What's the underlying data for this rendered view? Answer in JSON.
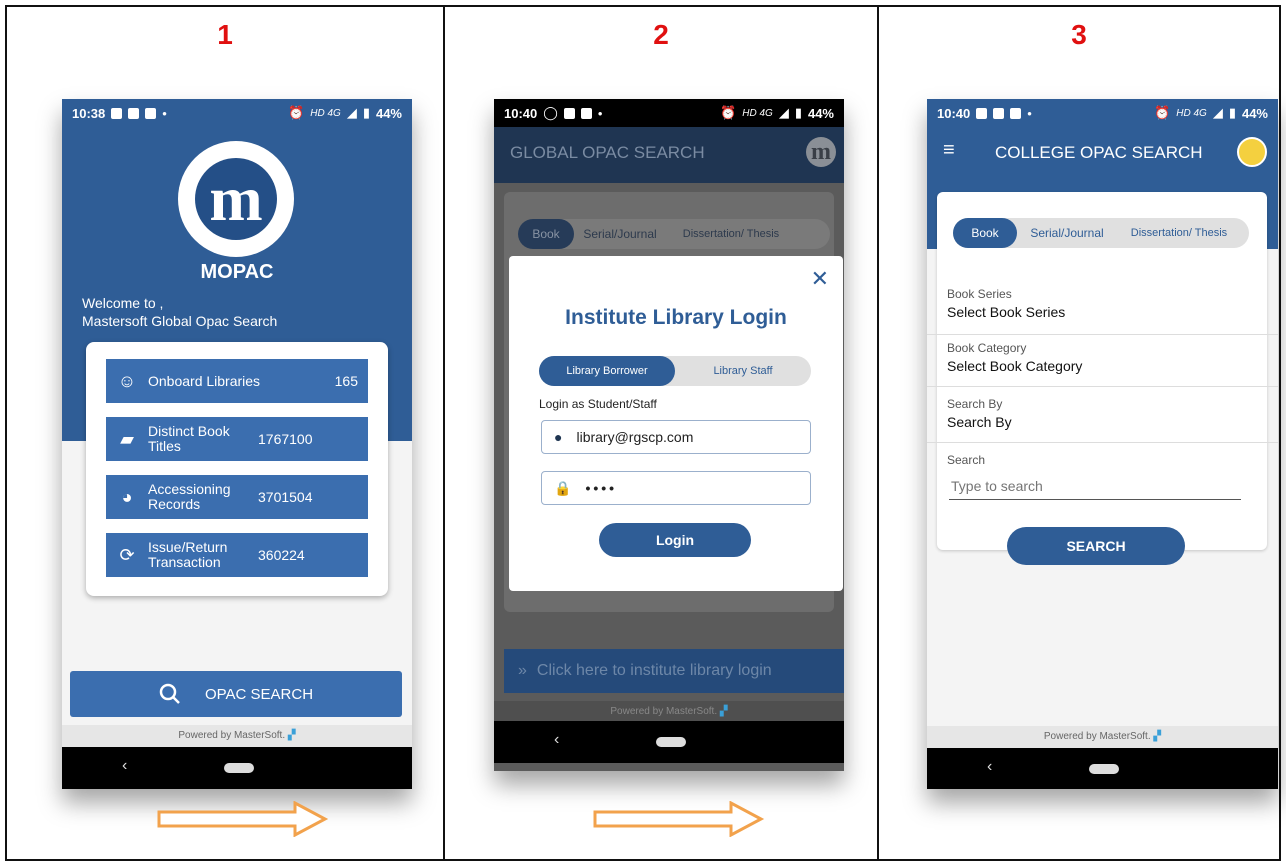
{
  "steps": [
    "1",
    "2",
    "3"
  ],
  "colors": {
    "step_number": "#e01010",
    "brand_blue": "#2f5d96",
    "button_blue": "#3b6eaf",
    "arrow_orange": "#f2a24c"
  },
  "phone1": {
    "status": {
      "time": "10:38",
      "battery": "44%",
      "network": "HD 4G"
    },
    "logo": {
      "icon": "mopac-logo-icon",
      "title": "MOPAC"
    },
    "welcome_line1": "Welcome to ,",
    "welcome_line2": "Mastersoft Global Opac Search",
    "stats": [
      {
        "icon": "smiley-icon",
        "label": "Onboard Libraries",
        "value": "165"
      },
      {
        "icon": "book-icon",
        "label": "Distinct Book Titles",
        "value": "1767100"
      },
      {
        "icon": "pie-chart-icon",
        "label": "Accessioning Records",
        "value": "3701504"
      },
      {
        "icon": "refresh-icon",
        "label": "Issue/Return Transaction",
        "value": "360224"
      }
    ],
    "opac_button": "OPAC SEARCH",
    "powered_by": "Powered by MasterSoft."
  },
  "phone2": {
    "status": {
      "time": "10:40",
      "battery": "44%",
      "network": "HD 4G"
    },
    "app_title": "GLOBAL OPAC SEARCH",
    "tabs": [
      "Book",
      "Serial/Journal",
      "Dissertation/ Thesis"
    ],
    "modal": {
      "title": "Institute Library Login",
      "toggle": [
        "Library Borrower",
        "Library Staff"
      ],
      "login_as": "Login as Student/Staff",
      "username": "library@rgscp.com",
      "password": "••••",
      "login_button": "Login"
    },
    "bottom_button": "Click here to institute library login",
    "powered_by": "Powered by MasterSoft."
  },
  "phone3": {
    "status": {
      "time": "10:40",
      "battery": "44%",
      "network": "HD 4G"
    },
    "app_title": "COLLEGE OPAC SEARCH",
    "tabs": [
      "Book",
      "Serial/Journal",
      "Dissertation/ Thesis"
    ],
    "fields": [
      {
        "label": "Book Series",
        "value": "Select Book Series"
      },
      {
        "label": "Book Category",
        "value": "Select Book Category"
      },
      {
        "label": "Search By",
        "value": "Search By"
      }
    ],
    "search_label": "Search",
    "search_placeholder": "Type to search",
    "search_button": "SEARCH",
    "powered_by": "Powered by MasterSoft."
  }
}
